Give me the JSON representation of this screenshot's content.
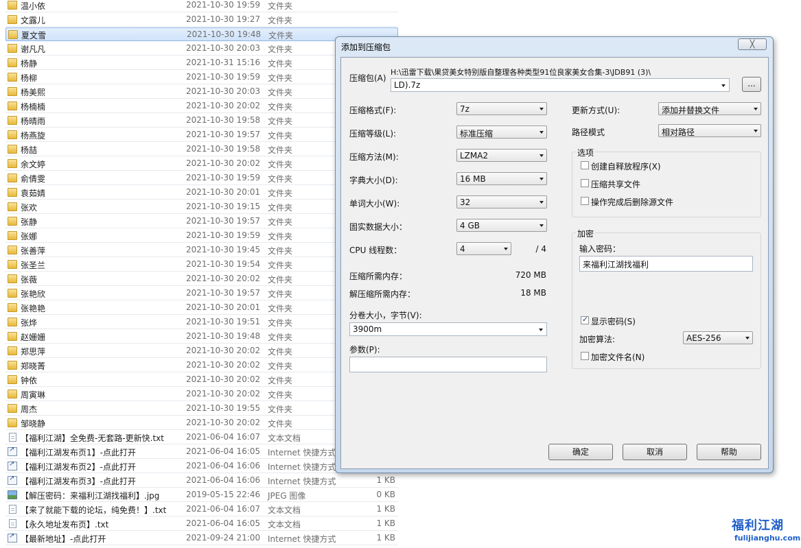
{
  "file_list": {
    "rows": [
      {
        "name": "温小依",
        "date": "2021-10-30 19:59",
        "type": "文件夹",
        "size": "",
        "icon": "folder-icon"
      },
      {
        "name": "文露儿",
        "date": "2021-10-30 19:27",
        "type": "文件夹",
        "size": "",
        "icon": "folder-icon"
      },
      {
        "name": "夏文雪",
        "date": "2021-10-30 19:48",
        "type": "文件夹",
        "size": "",
        "icon": "folder-icon",
        "selected": true
      },
      {
        "name": "谢凡凡",
        "date": "2021-10-30 20:03",
        "type": "文件夹",
        "size": "",
        "icon": "folder-icon"
      },
      {
        "name": "杨静",
        "date": "2021-10-31 15:16",
        "type": "文件夹",
        "size": "",
        "icon": "folder-icon"
      },
      {
        "name": "杨柳",
        "date": "2021-10-30 19:59",
        "type": "文件夹",
        "size": "",
        "icon": "folder-icon"
      },
      {
        "name": "杨美熙",
        "date": "2021-10-30 20:03",
        "type": "文件夹",
        "size": "",
        "icon": "folder-icon"
      },
      {
        "name": "杨楠楠",
        "date": "2021-10-30 20:02",
        "type": "文件夹",
        "size": "",
        "icon": "folder-icon"
      },
      {
        "name": "杨晴雨",
        "date": "2021-10-30 19:58",
        "type": "文件夹",
        "size": "",
        "icon": "folder-icon"
      },
      {
        "name": "杨燕旋",
        "date": "2021-10-30 19:57",
        "type": "文件夹",
        "size": "",
        "icon": "folder-icon"
      },
      {
        "name": "杨喆",
        "date": "2021-10-30 19:58",
        "type": "文件夹",
        "size": "",
        "icon": "folder-icon"
      },
      {
        "name": "余文婷",
        "date": "2021-10-30 20:02",
        "type": "文件夹",
        "size": "",
        "icon": "folder-icon"
      },
      {
        "name": "俞倩雯",
        "date": "2021-10-30 19:59",
        "type": "文件夹",
        "size": "",
        "icon": "folder-icon"
      },
      {
        "name": "袁茹婧",
        "date": "2021-10-30 20:01",
        "type": "文件夹",
        "size": "",
        "icon": "folder-icon"
      },
      {
        "name": "张欢",
        "date": "2021-10-30 19:15",
        "type": "文件夹",
        "size": "",
        "icon": "folder-icon"
      },
      {
        "name": "张静",
        "date": "2021-10-30 19:57",
        "type": "文件夹",
        "size": "",
        "icon": "folder-icon"
      },
      {
        "name": "张娜",
        "date": "2021-10-30 19:59",
        "type": "文件夹",
        "size": "",
        "icon": "folder-icon"
      },
      {
        "name": "张善萍",
        "date": "2021-10-30 19:45",
        "type": "文件夹",
        "size": "",
        "icon": "folder-icon"
      },
      {
        "name": "张圣兰",
        "date": "2021-10-30 19:54",
        "type": "文件夹",
        "size": "",
        "icon": "folder-icon"
      },
      {
        "name": "张薇",
        "date": "2021-10-30 20:02",
        "type": "文件夹",
        "size": "",
        "icon": "folder-icon"
      },
      {
        "name": "张艳欣",
        "date": "2021-10-30 19:57",
        "type": "文件夹",
        "size": "",
        "icon": "folder-icon"
      },
      {
        "name": "张艳艳",
        "date": "2021-10-30 20:01",
        "type": "文件夹",
        "size": "",
        "icon": "folder-icon"
      },
      {
        "name": "张烨",
        "date": "2021-10-30 19:51",
        "type": "文件夹",
        "size": "",
        "icon": "folder-icon"
      },
      {
        "name": "赵姗姗",
        "date": "2021-10-30 19:48",
        "type": "文件夹",
        "size": "",
        "icon": "folder-icon"
      },
      {
        "name": "郑思萍",
        "date": "2021-10-30 20:02",
        "type": "文件夹",
        "size": "",
        "icon": "folder-icon"
      },
      {
        "name": "郑晓菁",
        "date": "2021-10-30 20:02",
        "type": "文件夹",
        "size": "",
        "icon": "folder-icon"
      },
      {
        "name": "钟依",
        "date": "2021-10-30 20:02",
        "type": "文件夹",
        "size": "",
        "icon": "folder-icon"
      },
      {
        "name": "周寅琳",
        "date": "2021-10-30 20:02",
        "type": "文件夹",
        "size": "",
        "icon": "folder-icon"
      },
      {
        "name": "周杰",
        "date": "2021-10-30 19:55",
        "type": "文件夹",
        "size": "",
        "icon": "folder-icon"
      },
      {
        "name": "邹晓静",
        "date": "2021-10-30 20:02",
        "type": "文件夹",
        "size": "",
        "icon": "folder-icon"
      },
      {
        "name": "【福利江湖】全免费-无套路-更新快.txt",
        "date": "2021-06-04 16:07",
        "type": "文本文档",
        "size": "",
        "icon": "text-file-icon"
      },
      {
        "name": "【福利江湖发布页1】-点此打开",
        "date": "2021-06-04 16:05",
        "type": "Internet 快捷方式",
        "size": "",
        "icon": "shortcut-icon"
      },
      {
        "name": "【福利江湖发布页2】-点此打开",
        "date": "2021-06-04 16:06",
        "type": "Internet 快捷方式",
        "size": "",
        "icon": "shortcut-icon"
      },
      {
        "name": "【福利江湖发布页3】-点此打开",
        "date": "2021-06-04 16:06",
        "type": "Internet 快捷方式",
        "size": "1 KB",
        "icon": "shortcut-icon"
      },
      {
        "name": "【解压密码：来福利江湖找福利】.jpg",
        "date": "2019-05-15 22:46",
        "type": "JPEG 图像",
        "size": "0 KB",
        "icon": "image-file-icon"
      },
      {
        "name": "【来了就能下载的论坛，纯免费！】.txt",
        "date": "2021-06-04 16:07",
        "type": "文本文档",
        "size": "1 KB",
        "icon": "text-file-icon"
      },
      {
        "name": "【永久地址发布页】.txt",
        "date": "2021-06-04 16:05",
        "type": "文本文档",
        "size": "1 KB",
        "icon": "text-file-icon"
      },
      {
        "name": "【最新地址】-点此打开",
        "date": "2021-09-24 21:00",
        "type": "Internet 快捷方式",
        "size": "1 KB",
        "icon": "shortcut-icon"
      }
    ]
  },
  "dialog": {
    "title": "添加到压缩包",
    "close_label": "╳",
    "archive": {
      "label": "压缩包(A)",
      "path_line1": "H:\\迅雷下载\\果贷美女特别版自整理各种类型91位良家美女合集-3\\JDB91 (3)\\",
      "path_line2": "LD).7z",
      "browse_label": "..."
    },
    "format": {
      "label": "压缩格式(F):",
      "value": "7z"
    },
    "level": {
      "label": "压缩等级(L):",
      "value": "标准压缩"
    },
    "method": {
      "label": "压缩方法(M):",
      "value": "LZMA2"
    },
    "dict": {
      "label": "字典大小(D):",
      "value": "16 MB"
    },
    "word": {
      "label": "单词大小(W):",
      "value": "32"
    },
    "solid": {
      "label": "固实数据大小：",
      "value": "4 GB"
    },
    "threads": {
      "label": "CPU 线程数：",
      "value": "4",
      "max": "/ 4"
    },
    "mem_compress": {
      "label": "压缩所需内存：",
      "value": "720 MB"
    },
    "mem_decompress": {
      "label": "解压缩所需内存：",
      "value": "18 MB"
    },
    "volume": {
      "label": "分卷大小，字节(V):",
      "value": "3900m"
    },
    "params": {
      "label": "参数(P):",
      "value": ""
    },
    "update": {
      "label": "更新方式(U):",
      "value": "添加并替换文件"
    },
    "path_mode": {
      "label": "路径模式",
      "value": "相对路径"
    },
    "options": {
      "title": "选项",
      "items": [
        {
          "label": "创建自释放程序(X)",
          "checked": false
        },
        {
          "label": "压缩共享文件",
          "checked": false
        },
        {
          "label": "操作完成后删除源文件",
          "checked": false
        }
      ]
    },
    "encryption": {
      "title": "加密",
      "password_label": "输入密码：",
      "password_value": "来福利江湖找福利",
      "show_password_label": "显示密码(S)",
      "show_password_checked": true,
      "method_label": "加密算法:",
      "method_value": "AES-256",
      "encrypt_names_label": "加密文件名(N)",
      "encrypt_names_checked": false
    },
    "buttons": {
      "ok": "确定",
      "cancel": "取消",
      "help": "帮助"
    }
  },
  "watermark": {
    "main": "福利江湖",
    "url": "fulijianghu.com"
  }
}
